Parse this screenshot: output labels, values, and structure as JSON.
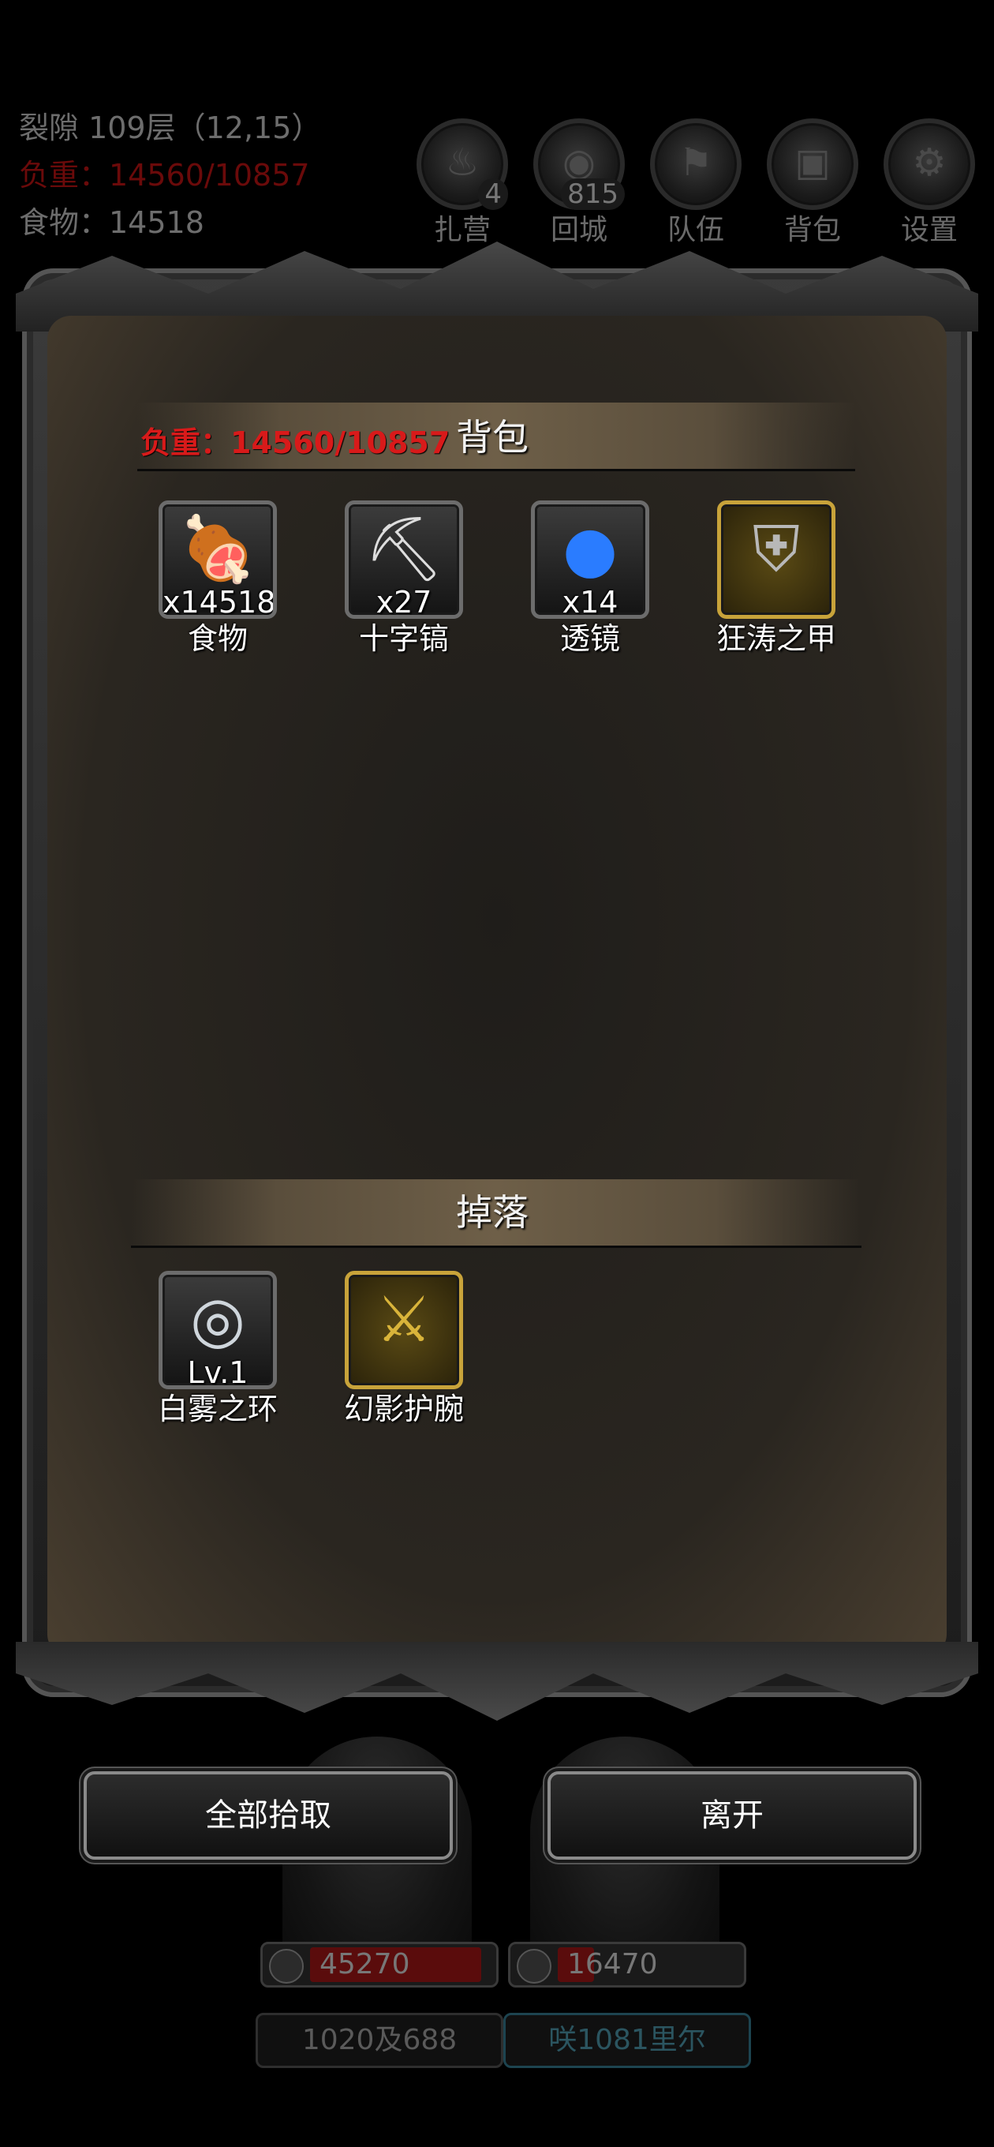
{
  "hud": {
    "location": "裂隙 109层（12,15）",
    "load": "负重：14560/10857",
    "food": "食物：14518"
  },
  "top_buttons": [
    {
      "label": "扎营",
      "badge": "4",
      "icon": "campfire-icon"
    },
    {
      "label": "回城",
      "badge": "815",
      "icon": "portal-icon"
    },
    {
      "label": "队伍",
      "badge": "",
      "icon": "team-icon"
    },
    {
      "label": "背包",
      "badge": "",
      "icon": "chest-icon"
    },
    {
      "label": "设置",
      "badge": "",
      "icon": "gear-icon"
    }
  ],
  "inventory": {
    "title": "背包",
    "load": "负重：14560/10857",
    "items": [
      {
        "name": "食物",
        "qty": "x14518",
        "icon": "meat-icon"
      },
      {
        "name": "十字镐",
        "qty": "x27",
        "icon": "pickaxe-icon"
      },
      {
        "name": "透镜",
        "qty": "x14",
        "icon": "lens-orb-icon"
      },
      {
        "name": "狂涛之甲",
        "qty": "",
        "icon": "armor-icon"
      }
    ]
  },
  "drops": {
    "title": "掉落",
    "items": [
      {
        "name": "白雾之环",
        "qty": "Lv.1",
        "icon": "ring-icon"
      },
      {
        "name": "幻影护腕",
        "qty": "",
        "icon": "bracer-icon"
      }
    ]
  },
  "actions": {
    "pick_all": "全部拾取",
    "leave": "离开"
  },
  "party": [
    {
      "hp": "45270",
      "name": "1020及688",
      "hp_fill": 0.95
    },
    {
      "hp": "16470",
      "name": "咲1081里尔",
      "hp_fill": 0.2
    }
  ]
}
